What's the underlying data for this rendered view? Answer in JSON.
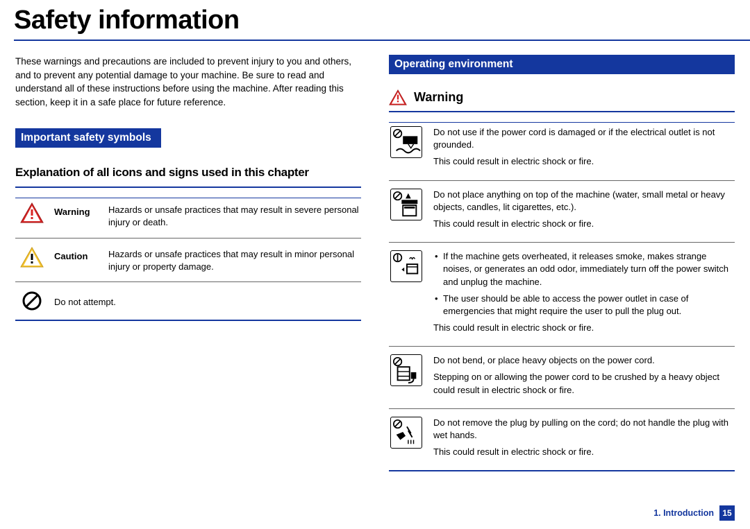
{
  "title": "Safety information",
  "intro": "These warnings and precautions are included to prevent injury to you and others, and to prevent any potential damage to your machine. Be sure to read and understand all of these instructions before using the machine. After reading this section, keep it in a safe place for future reference.",
  "sections": {
    "symbols_header": "Important safety symbols",
    "symbols_subheading": "Explanation of all icons and signs used in this chapter",
    "env_header": "Operating environment",
    "warning_label": "Warning"
  },
  "symbols": [
    {
      "label": "Warning",
      "desc": "Hazards or unsafe practices that may result in severe personal injury or death."
    },
    {
      "label": "Caution",
      "desc": "Hazards or unsafe practices that may result in minor personal injury or property damage."
    },
    {
      "label": "",
      "desc": "Do not attempt."
    }
  ],
  "warnings": [
    {
      "text1": "Do not use if the power cord is damaged or if the electrical outlet is not grounded.",
      "text2": "This could result in electric shock or fire."
    },
    {
      "text1": "Do not place anything on top of the machine (water, small metal or heavy objects, candles, lit cigarettes, etc.).",
      "text2": "This could result in electric shock or fire."
    },
    {
      "bullet1": "If the machine gets overheated, it releases smoke, makes strange noises, or generates an odd odor, immediately turn off the power switch and unplug the machine.",
      "bullet2": "The user should be able to access the power outlet in case of emergencies that might require the user to pull the plug out.",
      "text2": "This could result in electric shock or fire."
    },
    {
      "text1": "Do not bend, or place heavy objects on the power cord.",
      "text2": "Stepping on or allowing the power cord to be crushed by a heavy object could result in electric shock or fire."
    },
    {
      "text1": "Do not remove the plug by pulling on the cord; do not handle the plug with wet hands.",
      "text2": "This could result in electric shock or fire."
    }
  ],
  "footer": {
    "chapter": "1.  Introduction",
    "page": "15"
  }
}
